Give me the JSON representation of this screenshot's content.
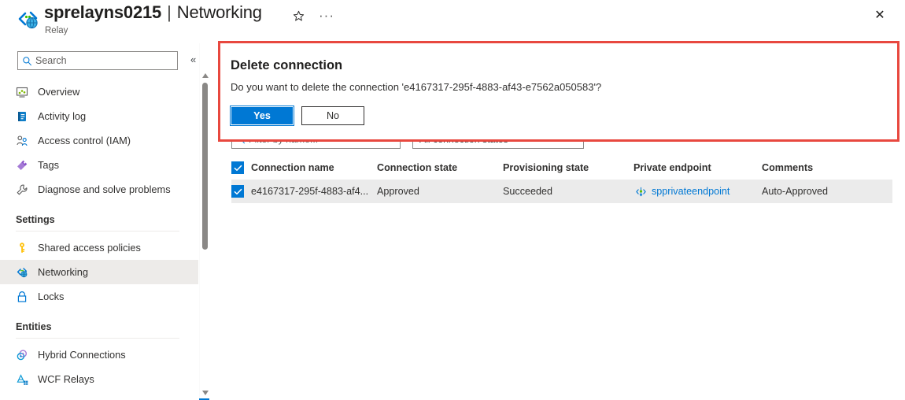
{
  "header": {
    "resource_name": "sprelayns0215",
    "separator": "|",
    "page_name": "Networking",
    "resource_type": "Relay",
    "star_icon": "star-icon",
    "ellipsis": "···",
    "close_icon": "✕"
  },
  "sidebar": {
    "search": {
      "placeholder": "Search",
      "value": ""
    },
    "collapse_label": "«",
    "items": [
      {
        "label": "Overview",
        "icon": "overview-icon",
        "selected": false
      },
      {
        "label": "Activity log",
        "icon": "activity-log-icon",
        "selected": false
      },
      {
        "label": "Access control (IAM)",
        "icon": "access-control-icon",
        "selected": false
      },
      {
        "label": "Tags",
        "icon": "tags-icon",
        "selected": false
      },
      {
        "label": "Diagnose and solve problems",
        "icon": "diagnose-icon",
        "selected": false
      }
    ],
    "group_settings": "Settings",
    "settings_items": [
      {
        "label": "Shared access policies",
        "icon": "key-icon",
        "selected": false
      },
      {
        "label": "Networking",
        "icon": "networking-icon",
        "selected": true
      },
      {
        "label": "Locks",
        "icon": "lock-icon",
        "selected": false
      }
    ],
    "group_entities": "Entities",
    "entities_items": [
      {
        "label": "Hybrid Connections",
        "icon": "hybrid-connections-icon",
        "selected": false
      },
      {
        "label": "WCF Relays",
        "icon": "wcf-relays-icon",
        "selected": false
      }
    ]
  },
  "filters": {
    "name_filter_placeholder": "Filter by name...",
    "name_filter_value": "",
    "state_filter_value": "All connection states"
  },
  "table": {
    "columns": [
      "Connection name",
      "Connection state",
      "Provisioning state",
      "Private endpoint",
      "Comments"
    ],
    "rows": [
      {
        "checked": true,
        "connection_name": "e4167317-295f-4883-af4...",
        "connection_state": "Approved",
        "provisioning_state": "Succeeded",
        "private_endpoint": "spprivateendpoint",
        "comments": "Auto-Approved"
      }
    ],
    "header_checkbox_checked": true
  },
  "dialog": {
    "title": "Delete connection",
    "message": "Do you want to delete the connection 'e4167317-295f-4883-af43-e7562a050583'?",
    "yes_label": "Yes",
    "no_label": "No",
    "highlight_color": "#e8483f"
  },
  "colors": {
    "accent": "#0078d4",
    "selected_nav": "#edebe9",
    "row_background": "#ebebeb",
    "highlight_border": "#e8483f"
  }
}
